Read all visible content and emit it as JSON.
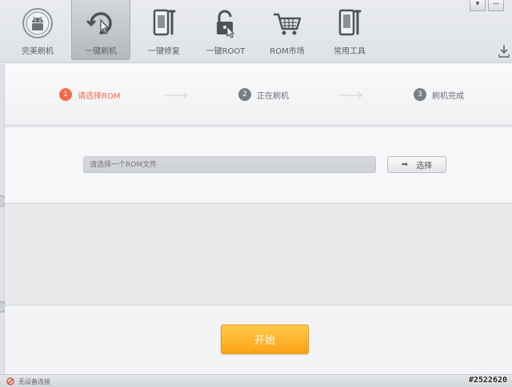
{
  "toolbar": {
    "items": [
      {
        "label": "完美刷机",
        "icon": "android-logo-icon"
      },
      {
        "label": "一键刷机",
        "icon": "one-click-flash-icon",
        "active": true
      },
      {
        "label": "一键修复",
        "icon": "repair-tool-icon"
      },
      {
        "label": "一键ROOT",
        "icon": "unlock-icon"
      },
      {
        "label": "ROM市场",
        "icon": "shopping-cart-icon"
      },
      {
        "label": "常用工具",
        "icon": "tools-icon"
      }
    ]
  },
  "window": {
    "menu_glyph": "▾",
    "minimize_glyph": "—"
  },
  "steps": [
    {
      "number": "1",
      "label": "请选择ROM",
      "state": "active",
      "color": "#f26b4b"
    },
    {
      "number": "2",
      "label": "正在刷机",
      "state": "pending",
      "color": "#7a7e84"
    },
    {
      "number": "3",
      "label": "刷机完成",
      "state": "pending",
      "color": "#7a7e84"
    }
  ],
  "chooser": {
    "placeholder": "请选择一个ROM文件",
    "button_label": "选择",
    "button_icon": "arrow-right-icon"
  },
  "start_button": {
    "label": "开始",
    "color": "#fba316"
  },
  "status": {
    "text": "无设备连接",
    "icon": "no-device-icon"
  },
  "watermark": "#2522620",
  "colors": {
    "accent": "#f26b4b",
    "primary_button": "#fba316"
  }
}
